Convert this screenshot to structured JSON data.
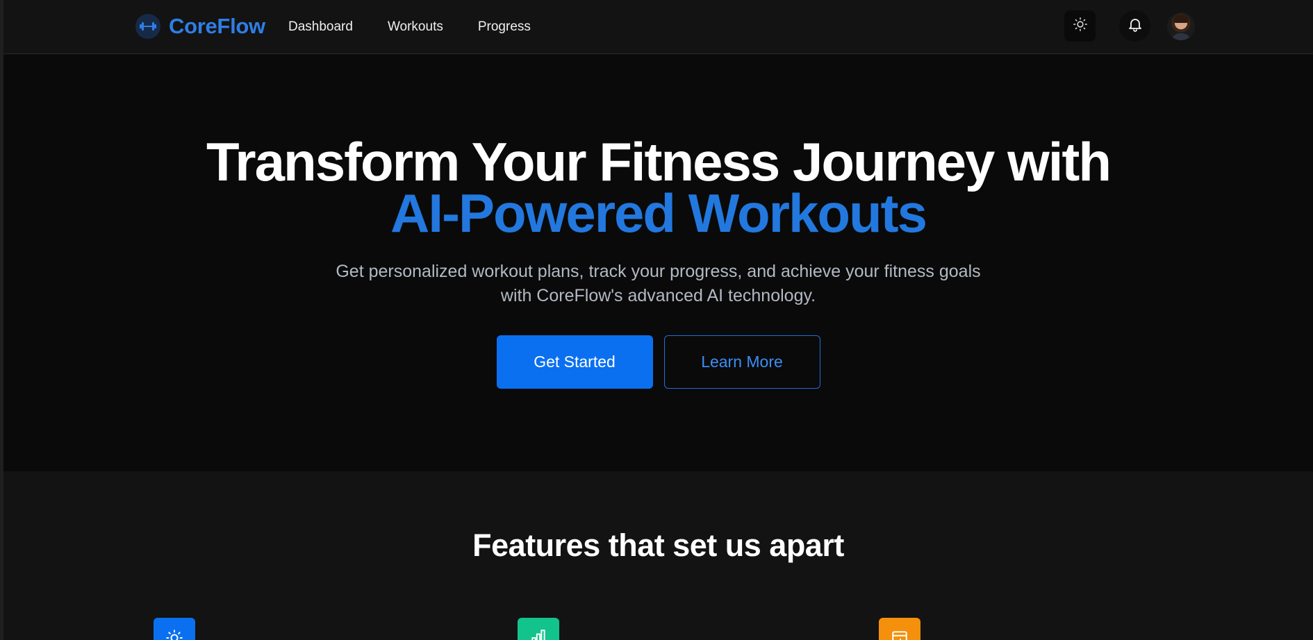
{
  "brand": {
    "name": "CoreFlow",
    "accent_color": "#2f7ee6"
  },
  "nav": {
    "links": [
      "Dashboard",
      "Workouts",
      "Progress"
    ]
  },
  "header_actions": {
    "theme_icon": "sun-icon",
    "notification_icon": "bell-icon",
    "avatar": "user-avatar"
  },
  "hero": {
    "title_line1": "Transform Your Fitness Journey with",
    "title_line2": "AI-Powered Workouts",
    "subtitle": "Get personalized workout plans, track your progress, and achieve your fitness goals with CoreFlow's advanced AI technology.",
    "primary_cta": "Get Started",
    "secondary_cta": "Learn More",
    "primary_color": "#0a70f0"
  },
  "features": {
    "title": "Features that set us apart",
    "cards": [
      {
        "icon": "sun-icon",
        "color": "#0a70f0"
      },
      {
        "icon": "bar-chart-icon",
        "color": "#12c48b"
      },
      {
        "icon": "calendar-add-icon",
        "color": "#f4900c"
      }
    ]
  }
}
